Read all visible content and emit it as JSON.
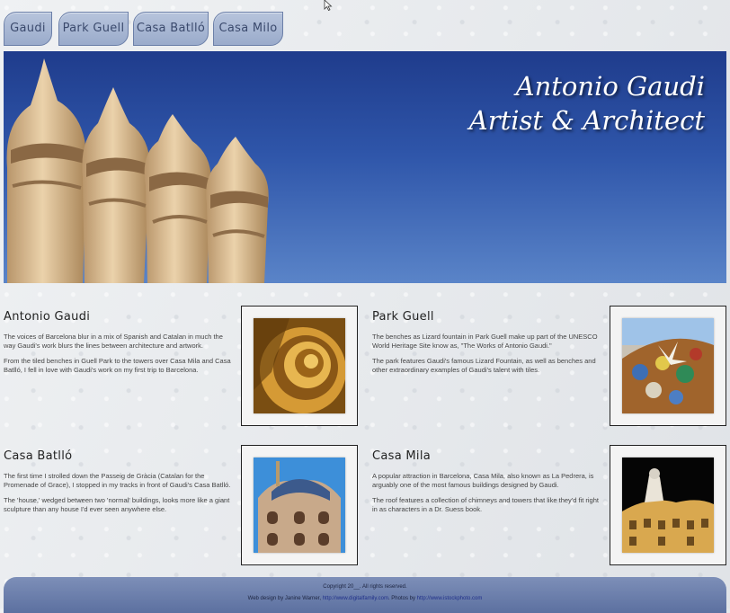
{
  "nav": {
    "tabs": [
      {
        "label": "Gaudi"
      },
      {
        "label": "Park Guell"
      },
      {
        "label": "Casa Batlló"
      },
      {
        "label": "Casa Milo"
      }
    ]
  },
  "hero": {
    "title_line1": "Antonio Gaudi",
    "title_line2": "Artist & Architect"
  },
  "sections": [
    {
      "title": "Antonio Gaudi",
      "p1": "The voices of Barcelona blur in a mix of Spanish and Catalan in much the way Gaudi's work blurs the lines between architecture and artwork.",
      "p2": "From the tiled benches in Guell Park to the towers over Casa Mila and Casa Batlló, I fell in love with Gaudi's work on my first trip to Barcelona."
    },
    {
      "title": "Park Guell",
      "p1": "The benches as Lizard fountain in Park Guell make up part of the UNESCO World Heritage Site know as, \"The Works of Antonio Gaudi.\"",
      "p2": "The park features Gaudi's famous Lizard Fountain, as well as benches and other extraordinary examples of Gaudi's talent with tiles."
    },
    {
      "title": "Casa Batlló",
      "p1": "The first time I strolled down the Passeig de Gràcia (Catalan for the Promenade of Grace), I stopped in my tracks in front of Gaudi's Casa Batlló.",
      "p2": "The 'house,' wedged between two 'normal' buildings, looks more like a giant sculpture than any house I'd ever seen anywhere else."
    },
    {
      "title": "Casa Mila",
      "p1": "A popular attraction in Barcelona, Casa Mila, also known as La Pedrera, is arguably one of the most famous buildings designed by Gaudi.",
      "p2": "The roof features a collection of chimneys and towers that like they'd fit right in as characters in a Dr. Suess book."
    }
  ],
  "footer": {
    "copyright": "Copyright 20__. All rights reserved.",
    "design_prefix": "Web design by Janine Warner,",
    "design_link": "http://www.digitalfamily.com",
    "photos_prefix": ". Photos by",
    "photos_link": "http://www.istockphoto.com"
  },
  "colors": {
    "tab": "#a9b8d6",
    "hero_sky": "#2f56aa",
    "footer": "#6b7fac"
  }
}
